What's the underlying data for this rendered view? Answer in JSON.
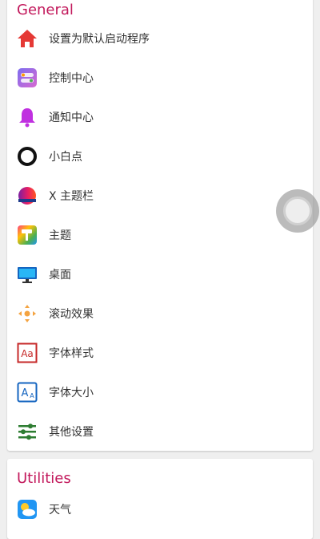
{
  "general": {
    "title": "General",
    "items": [
      {
        "label": "设置为默认启动程序",
        "icon": "home-icon"
      },
      {
        "label": "控制中心",
        "icon": "toggle-panel-icon"
      },
      {
        "label": "通知中心",
        "icon": "bell-icon"
      },
      {
        "label": "小白点",
        "icon": "ring-dot-icon"
      },
      {
        "label": "X 主题栏",
        "icon": "theme-bar-icon"
      },
      {
        "label": "主题",
        "icon": "paint-roller-icon"
      },
      {
        "label": "桌面",
        "icon": "monitor-icon"
      },
      {
        "label": "滚动效果",
        "icon": "scroll-arrows-icon"
      },
      {
        "label": "字体样式",
        "icon": "font-style-icon"
      },
      {
        "label": "字体大小",
        "icon": "font-size-icon"
      },
      {
        "label": "其他设置",
        "icon": "sliders-icon"
      }
    ]
  },
  "utilities": {
    "title": "Utilities",
    "items": [
      {
        "label": "天气",
        "icon": "weather-icon"
      }
    ]
  },
  "colors": {
    "section_title": "#c2185b",
    "card": "#ffffff",
    "background": "#efefef"
  }
}
